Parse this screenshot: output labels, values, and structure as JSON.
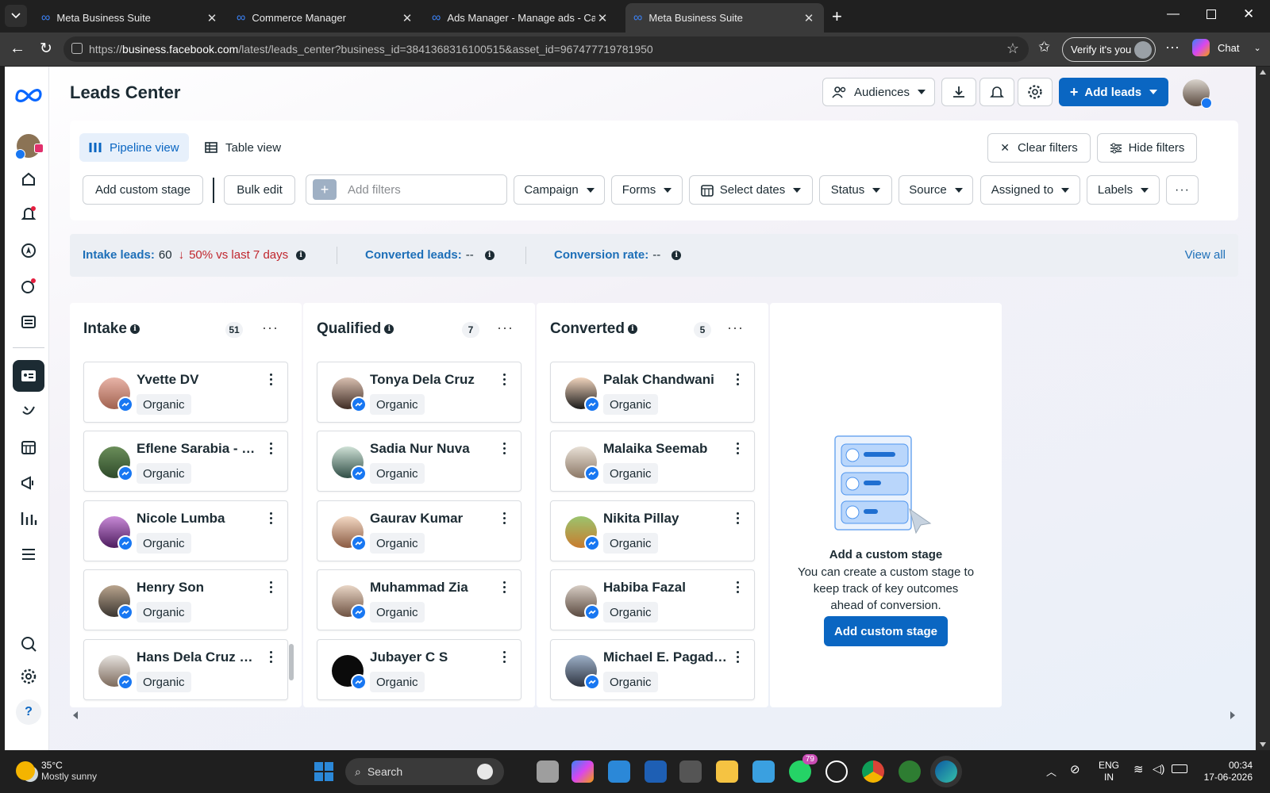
{
  "browser": {
    "tabs": [
      {
        "title": "Meta Business Suite"
      },
      {
        "title": "Commerce Manager"
      },
      {
        "title": "Ads Manager - Manage ads - Cam"
      },
      {
        "title": "Meta Business Suite"
      }
    ],
    "url_prefix": "https://",
    "url_domain": "business.facebook.com",
    "url_path": "/latest/leads_center?business_id=3841368316100515&asset_id=967477719781950",
    "verify_label": "Verify it's you",
    "chat_label": "Chat"
  },
  "header": {
    "title": "Leads Center",
    "audiences_label": "Audiences",
    "add_leads_label": "Add leads"
  },
  "views": {
    "pipeline_label": "Pipeline view",
    "table_label": "Table view",
    "clear_filters_label": "Clear filters",
    "hide_filters_label": "Hide filters"
  },
  "filters": {
    "add_custom_stage_label": "Add custom stage",
    "bulk_edit_label": "Bulk edit",
    "add_filters_placeholder": "Add filters",
    "dropdowns": [
      "Campaign",
      "Forms",
      "Select dates",
      "Status",
      "Source",
      "Assigned to",
      "Labels"
    ]
  },
  "stats": {
    "intake_label": "Intake leads:",
    "intake_value": "60",
    "intake_change": "50% vs last 7 days",
    "converted_label": "Converted leads:",
    "converted_value": "--",
    "rate_label": "Conversion rate:",
    "rate_value": "--",
    "view_all_label": "View all"
  },
  "columns": [
    {
      "title": "Intake",
      "count": "51",
      "cards": [
        {
          "name": "Yvette DV",
          "tag": "Organic"
        },
        {
          "name": "Eflene Sarabia - L...",
          "tag": "Organic"
        },
        {
          "name": "Nicole Lumba",
          "tag": "Organic"
        },
        {
          "name": "Henry Son",
          "tag": "Organic"
        },
        {
          "name": "Hans Dela Cruz Tan",
          "tag": "Organic"
        }
      ]
    },
    {
      "title": "Qualified",
      "count": "7",
      "cards": [
        {
          "name": "Tonya Dela Cruz",
          "tag": "Organic"
        },
        {
          "name": "Sadia Nur Nuva",
          "tag": "Organic"
        },
        {
          "name": "Gaurav Kumar",
          "tag": "Organic"
        },
        {
          "name": "Muhammad Zia",
          "tag": "Organic"
        },
        {
          "name": "Jubayer C S",
          "tag": "Organic"
        }
      ]
    },
    {
      "title": "Converted",
      "count": "5",
      "cards": [
        {
          "name": "Palak Chandwani",
          "tag": "Organic"
        },
        {
          "name": "Malaika Seemab",
          "tag": "Organic"
        },
        {
          "name": "Nikita Pillay",
          "tag": "Organic"
        },
        {
          "name": "Habiba Fazal",
          "tag": "Organic"
        },
        {
          "name": "Michael E. Pagadora",
          "tag": "Organic"
        }
      ]
    }
  ],
  "custom_stage": {
    "title": "Add a custom stage",
    "description": "You can create a custom stage to keep track of key outcomes ahead of conversion.",
    "button_label": "Add custom stage"
  },
  "taskbar": {
    "weather_temp": "35°C",
    "weather_desc": "Mostly sunny",
    "search_label": "Search",
    "whatsapp_badge": "79",
    "lang_top": "ENG",
    "lang_bottom": "IN",
    "time": "00:34",
    "date": "17-06-2026"
  },
  "colors": {
    "brand_blue": "#0a66c2",
    "stat_blue": "#1d6fb8",
    "negative_red": "#c0262d",
    "messenger_blue": "#1877f2"
  }
}
